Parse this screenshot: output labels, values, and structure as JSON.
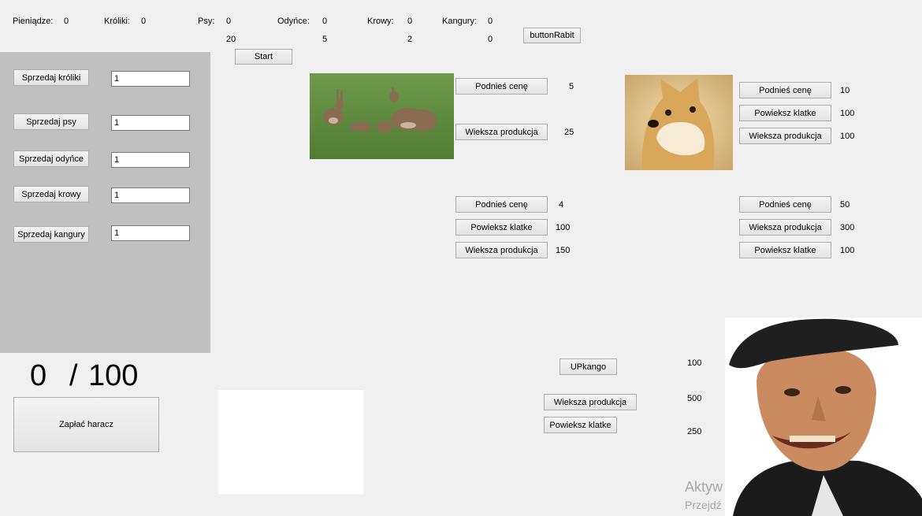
{
  "stats": [
    {
      "label": "Pieniądze:",
      "value": "0",
      "sub": ""
    },
    {
      "label": "Króliki:",
      "value": "0",
      "sub": ""
    },
    {
      "label": "Psy:",
      "value": "0",
      "sub": "20"
    },
    {
      "label": "Odyńce:",
      "value": "0",
      "sub": "5"
    },
    {
      "label": "Krowy:",
      "value": "0",
      "sub": "2"
    },
    {
      "label": "Kangury:",
      "value": "0",
      "sub": "0"
    }
  ],
  "top_buttons": {
    "start": "Start",
    "rabbit": "buttonRabit"
  },
  "sell": [
    {
      "label": "Sprzedaj króliki",
      "qty": "1"
    },
    {
      "label": "Sprzedaj psy",
      "qty": "1"
    },
    {
      "label": "Sprzedaj odyńce",
      "qty": "1"
    },
    {
      "label": "Sprzedaj krowy",
      "qty": "1"
    },
    {
      "label": "Sprzedaj kangury",
      "qty": "1"
    }
  ],
  "progress": {
    "current": "0",
    "sep": "/",
    "goal": "100"
  },
  "pay_button": "Zapłać haracz",
  "rabbit_section": {
    "raise_price": "Podnieś cenę",
    "raise_value": "5",
    "production": "Wieksza produkcja",
    "production_value": "25"
  },
  "dog_section": {
    "raise_price": "Podnieś cenę",
    "raise_value": "10",
    "cage": "Powieksz klatke",
    "cage_value": "100",
    "production": "Wieksza produkcja",
    "production_value": "100"
  },
  "boar_section": {
    "raise_price": "Podnieś cenę",
    "raise_value": "4",
    "cage": "Powieksz klatke",
    "cage_value": "100",
    "production": "Wieksza produkcja",
    "production_value": "150"
  },
  "cow_section": {
    "raise_price": "Podnieś cenę",
    "raise_value": "50",
    "production": "Wieksza produkcja",
    "production_value": "300",
    "cage": "Powieksz klatke",
    "cage_value": "100"
  },
  "kangaroo_section": {
    "up": "UPkango",
    "up_value": "100",
    "production": "Wieksza produkcja",
    "production_value": "500",
    "cage": "Powieksz klatke",
    "cage_value": "250"
  },
  "watermark": {
    "line1": "Aktyw",
    "line2": "Przejdź"
  }
}
